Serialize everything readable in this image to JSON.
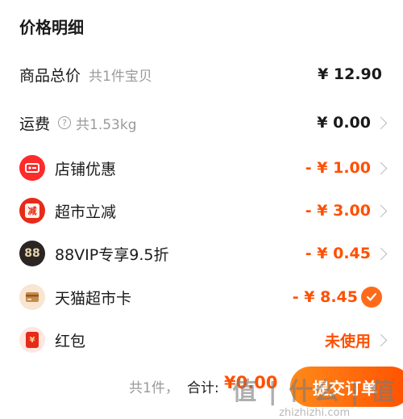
{
  "sheet": {
    "title": "价格明细",
    "rows": [
      {
        "label": "商品总价",
        "sub": "共1件宝贝",
        "price": "¥ 12.90"
      },
      {
        "label": "运费",
        "sub": "共1.53kg",
        "price": "¥ 0.00"
      },
      {
        "label": "店铺优惠",
        "price": "- ¥ 1.00",
        "icon": "coupon-icon"
      },
      {
        "label": "超市立减",
        "price": "- ¥ 3.00",
        "icon": "reduce-icon",
        "icon_text": "减"
      },
      {
        "label": "88VIP专享9.5折",
        "price": "- ¥ 0.45",
        "icon": "vip88-icon",
        "icon_text": "88"
      },
      {
        "label": "天猫超市卡",
        "price": "- ¥ 8.45",
        "icon": "card-icon"
      },
      {
        "label": "红包",
        "price": "未使用",
        "icon": "red-packet-icon",
        "icon_text": "¥"
      }
    ]
  },
  "bottom": {
    "count": "共1件，",
    "total_label": "合计:",
    "total_value": "¥0.00",
    "button": "提交订单"
  },
  "watermark": {
    "logo": "值 | 什么 | 值",
    "domain": "zhizhizhi.com"
  },
  "colors": {
    "accent": "#ff5000",
    "accent_light": "#ff8a1a",
    "text": "#1a1a1a",
    "muted": "#9a9a9a",
    "bg": "#f2f2f2"
  }
}
